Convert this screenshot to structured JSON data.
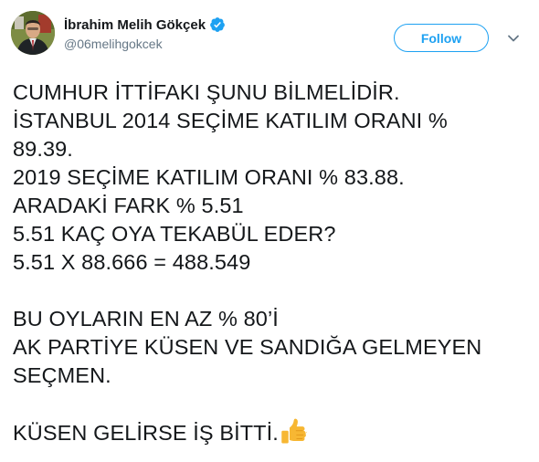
{
  "user": {
    "display_name": "İbrahim Melih Gökçek",
    "handle": "@06melihgokcek",
    "verified_icon": "verified-badge-icon",
    "avatar_icon": "profile-avatar"
  },
  "actions": {
    "follow_label": "Follow",
    "menu_icon": "chevron-down-icon"
  },
  "tweet": {
    "lines": [
      "CUMHUR İTTİFAKI ŞUNU BİLMELİDİR.",
      "İSTANBUL 2014 SEÇİME KATILIM ORANI %",
      "89.39.",
      "2019 SEÇİME KATILIM ORANI % 83.88.",
      "ARADAKİ FARK % 5.51",
      "5.51 KAÇ OYA TEKABÜL EDER?",
      "5.51 X 88.666 = 488.549",
      "",
      "BU OYLARIN EN AZ % 80’İ",
      "AK PARTİYE KÜSEN VE SANDIĞA GELMEYEN",
      "SEÇMEN.",
      "",
      "KÜSEN GELİRSE İŞ BİTTİ."
    ],
    "trailing_emoji": "thumbs-up-icon"
  },
  "colors": {
    "accent": "#1da1f2",
    "text": "#14171a",
    "secondary_text": "#657786",
    "emoji": "#f7b733"
  }
}
